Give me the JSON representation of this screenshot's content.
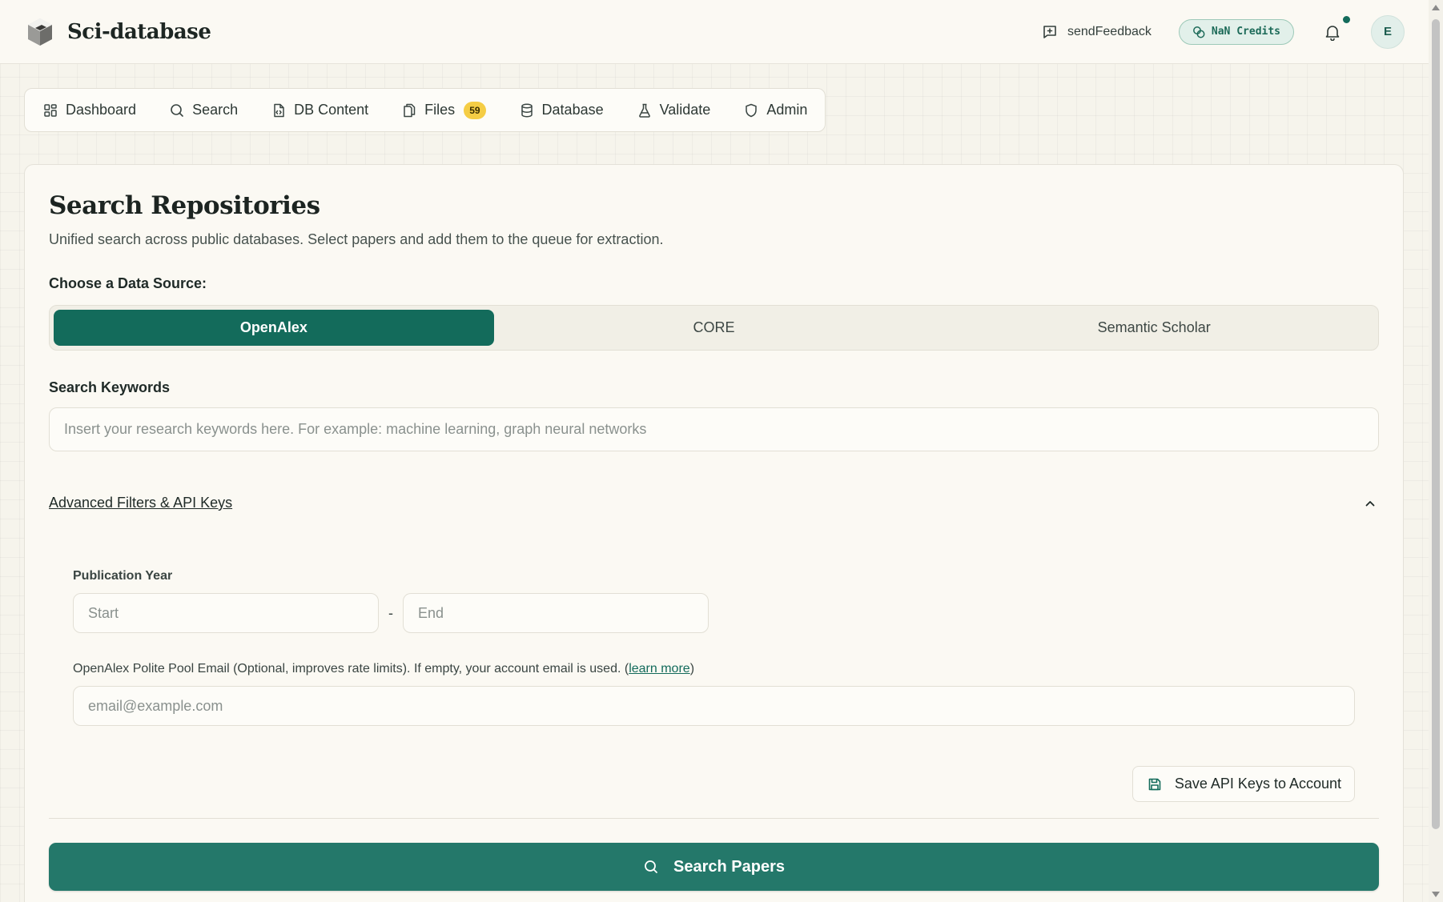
{
  "header": {
    "brand_name": "Sci-database",
    "feedback_label": "sendFeedback",
    "credits_label": "NaN Credits",
    "avatar_initial": "E"
  },
  "nav": {
    "items": [
      {
        "label": "Dashboard",
        "icon": "grid-icon"
      },
      {
        "label": "Search",
        "icon": "search-icon"
      },
      {
        "label": "DB Content",
        "icon": "file-code-icon"
      },
      {
        "label": "Files",
        "icon": "files-icon",
        "badge": "59"
      },
      {
        "label": "Database",
        "icon": "database-icon"
      },
      {
        "label": "Validate",
        "icon": "flask-icon"
      },
      {
        "label": "Admin",
        "icon": "shield-icon"
      }
    ]
  },
  "main": {
    "title": "Search Repositories",
    "subtitle": "Unified search across public databases. Select papers and add them to the queue for extraction.",
    "source_label": "Choose a Data Source:",
    "sources": [
      "OpenAlex",
      "CORE",
      "Semantic Scholar"
    ],
    "active_source": "OpenAlex",
    "keywords_label": "Search Keywords",
    "keywords_placeholder": "Insert your research keywords here. For example: machine learning, graph neural networks",
    "advanced_label": "Advanced Filters & API Keys",
    "advanced_expanded": true,
    "pub_year_label": "Publication Year",
    "start_placeholder": "Start",
    "year_separator": "-",
    "end_placeholder": "End",
    "email_label_prefix": "OpenAlex Polite Pool Email (Optional, improves rate limits). If empty, your account email is used. (",
    "email_learn_more": "learn more",
    "email_label_suffix": ")",
    "email_placeholder": "email@example.com",
    "save_button": "Save API Keys to Account",
    "search_button": "Search Papers"
  },
  "colors": {
    "accent": "#136b5b",
    "search_button": "#24786a",
    "badge": "#f5cd45",
    "background": "#f6f4ec"
  }
}
